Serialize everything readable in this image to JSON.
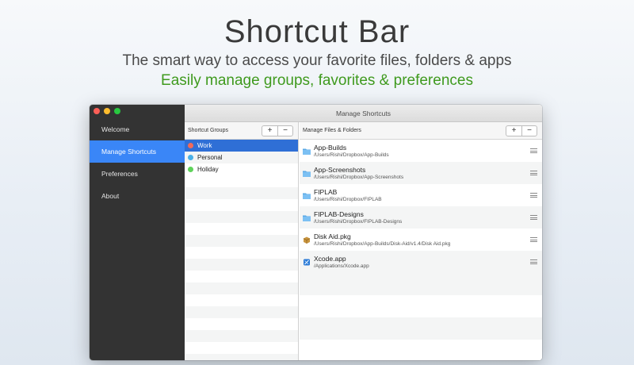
{
  "hero": {
    "title": "Shortcut Bar",
    "subtitle": "The smart way to access your favorite files, folders & apps",
    "subtitle2": "Easily manage groups, favorites & preferences"
  },
  "colors": {
    "accent": "#3a86f7",
    "selection": "#2f6fd6",
    "green_text": "#3f9a1e",
    "sidebar_bg": "#333333"
  },
  "sidebar": {
    "items": [
      {
        "label": "Welcome",
        "active": false
      },
      {
        "label": "Manage Shortcuts",
        "active": true
      },
      {
        "label": "Preferences",
        "active": false
      },
      {
        "label": "About",
        "active": false
      }
    ]
  },
  "window": {
    "title": "Manage Shortcuts"
  },
  "groups": {
    "header": "Shortcut Groups",
    "add_label": "+",
    "remove_label": "−",
    "items": [
      {
        "label": "Work",
        "color": "#f06a5a",
        "selected": true
      },
      {
        "label": "Personal",
        "color": "#4ab0e8",
        "selected": false
      },
      {
        "label": "Holiday",
        "color": "#5fd35a",
        "selected": false
      }
    ]
  },
  "files": {
    "header": "Manage Files & Folders",
    "add_label": "+",
    "remove_label": "−",
    "items": [
      {
        "name": "App-Builds",
        "path": "/Users/Rishi/Dropbox/App-Builds",
        "icon": "folder-icon"
      },
      {
        "name": "App-Screenshots",
        "path": "/Users/Rishi/Dropbox/App-Screenshots",
        "icon": "folder-icon"
      },
      {
        "name": "FIPLAB",
        "path": "/Users/Rishi/Dropbox/FIPLAB",
        "icon": "folder-icon"
      },
      {
        "name": "FIPLAB-Designs",
        "path": "/Users/Rishi/Dropbox/FIPLAB-Designs",
        "icon": "folder-icon"
      },
      {
        "name": "Disk Aid.pkg",
        "path": "/Users/Rishi/Dropbox/App-Builds/Disk-Aid/v1.4/Disk Aid.pkg",
        "icon": "package-icon"
      },
      {
        "name": "Xcode.app",
        "path": "/Applications/Xcode.app",
        "icon": "xcode-app-icon"
      }
    ]
  }
}
